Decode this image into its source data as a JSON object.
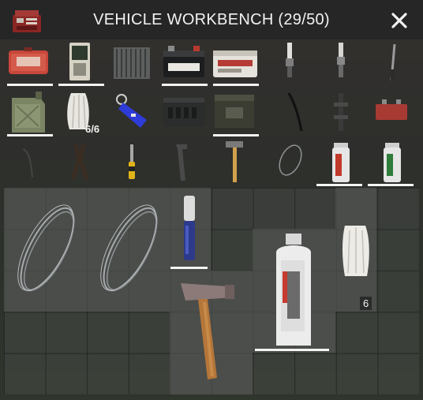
{
  "header": {
    "title": "VEHICLE WORKBENCH (29/50)",
    "close_icon": "close-x-icon",
    "container_icon": "workbench-icon"
  },
  "inventory": {
    "rows": [
      [
        {
          "item": "first-aid-case",
          "underline": true
        },
        {
          "item": "battery-charger-box",
          "underline": true
        },
        {
          "item": "car-radiator",
          "underline": false
        },
        {
          "item": "car-battery",
          "underline": true
        },
        {
          "item": "truck-battery",
          "underline": true
        },
        {
          "item": "spark-plug",
          "underline": false
        },
        {
          "item": "glow-plug",
          "underline": false
        },
        {
          "item": "screwdriver-thin",
          "underline": false
        }
      ],
      [
        {
          "item": "jerry-can",
          "underline": true
        },
        {
          "item": "rags-bundle",
          "underline": false,
          "quantity": "6/6"
        },
        {
          "item": "car-key-fob",
          "underline": false
        },
        {
          "item": "ammo-box",
          "underline": false
        },
        {
          "item": "toolbox-case",
          "underline": true
        },
        {
          "item": "wire-cable",
          "underline": false
        },
        {
          "item": "lug-wrench",
          "underline": false
        },
        {
          "item": "small-battery",
          "underline": false
        }
      ],
      [
        {
          "item": "metal-wire-hook",
          "underline": false
        },
        {
          "item": "pliers",
          "underline": false
        },
        {
          "item": "screwdriver",
          "underline": false
        },
        {
          "item": "pipe-wrench",
          "underline": false
        },
        {
          "item": "sledgehammer-small",
          "underline": false
        },
        {
          "item": "wire-coil",
          "underline": false
        },
        {
          "item": "spray-paint-can",
          "underline": true
        },
        {
          "item": "spray-paint-can-green",
          "underline": true
        }
      ]
    ]
  },
  "storage": {
    "items": [
      {
        "item": "metal-wire-coil"
      },
      {
        "item": "metal-wire-coil"
      },
      {
        "item": "blue-marker"
      },
      {
        "item": "hammer"
      },
      {
        "item": "spray-paint-can"
      },
      {
        "item": "rags",
        "quantity": "6"
      }
    ]
  },
  "colors": {
    "accent": "#f4f4f4",
    "panel": "#2d302f"
  }
}
